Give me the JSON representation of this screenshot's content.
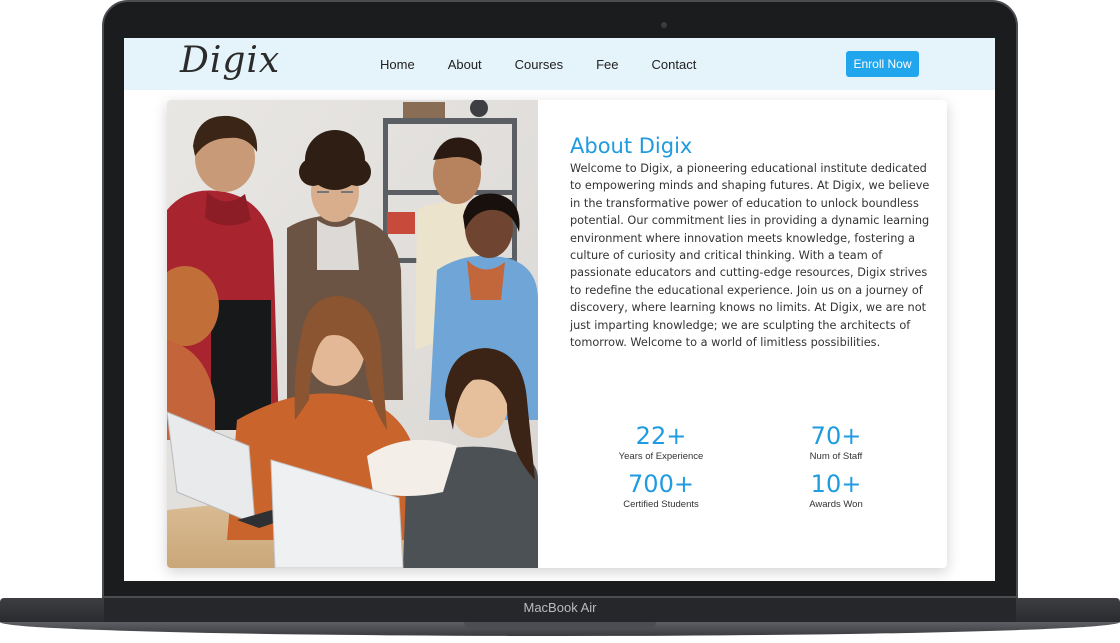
{
  "device": {
    "label": "MacBook Air"
  },
  "navbar": {
    "logo": "Digix",
    "links": [
      "Home",
      "About",
      "Courses",
      "Fee",
      "Contact"
    ],
    "cta_label": "Enroll Now"
  },
  "about": {
    "title": "About Digix",
    "body": "Welcome to Digix, a pioneering educational institute dedicated to empowering minds and shaping futures. At Digix, we believe in the transformative power of education to unlock boundless potential. Our commitment lies in providing a dynamic learning environment where innovation meets knowledge, fostering a culture of curiosity and critical thinking. With a team of passionate educators and cutting-edge resources, Digix strives to redefine the educational experience. Join us on a journey of discovery, where learning knows no limits. At Digix, we are not just imparting knowledge; we are sculpting the architects of tomorrow. Welcome to a world of limitless possibilities."
  },
  "stats": [
    {
      "value": "22+",
      "label": "Years of Experience"
    },
    {
      "value": "70+",
      "label": "Num of Staff"
    },
    {
      "value": "700+",
      "label": "Certified Students"
    },
    {
      "value": "10+",
      "label": "Awards Won"
    }
  ],
  "colors": {
    "accent": "#1f9be0",
    "button": "#21a5ec",
    "navbar_bg": "#e5f3fa"
  }
}
